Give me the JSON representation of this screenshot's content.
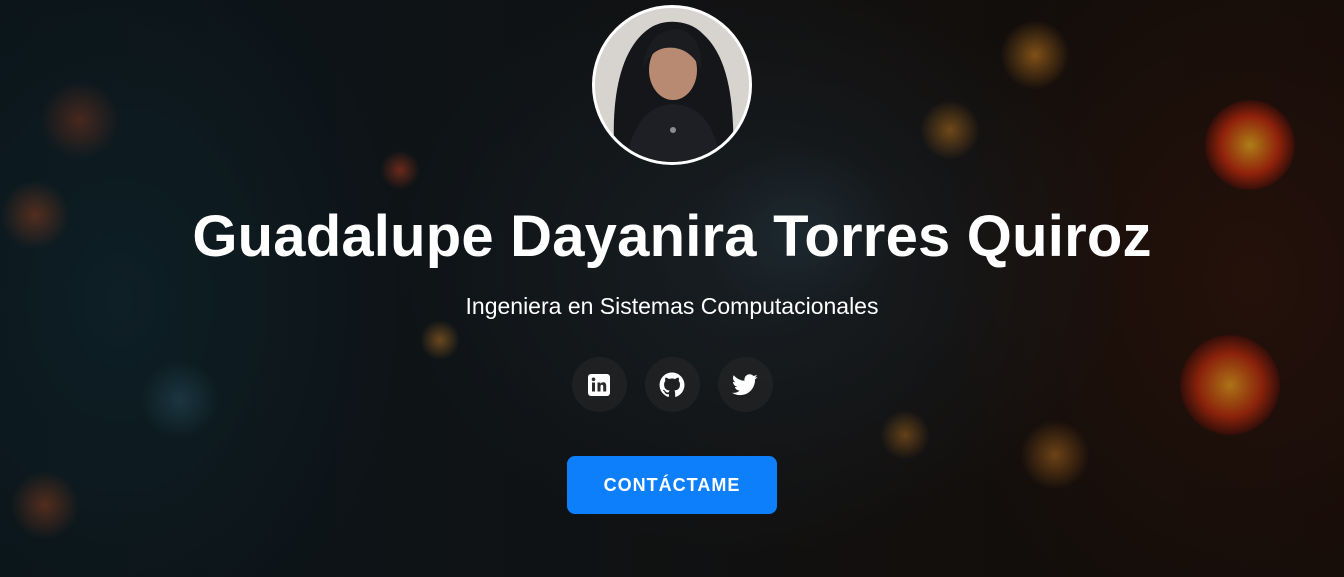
{
  "profile": {
    "name": "Guadalupe Dayanira Torres Quiroz",
    "title": "Ingeniera en Sistemas Computacionales"
  },
  "social_links": [
    {
      "icon": "linkedin-icon"
    },
    {
      "icon": "github-icon"
    },
    {
      "icon": "twitter-icon"
    }
  ],
  "cta": {
    "label": "CONTÁCTAME"
  },
  "colors": {
    "accent": "#0d7ffb",
    "text": "#ffffff"
  }
}
